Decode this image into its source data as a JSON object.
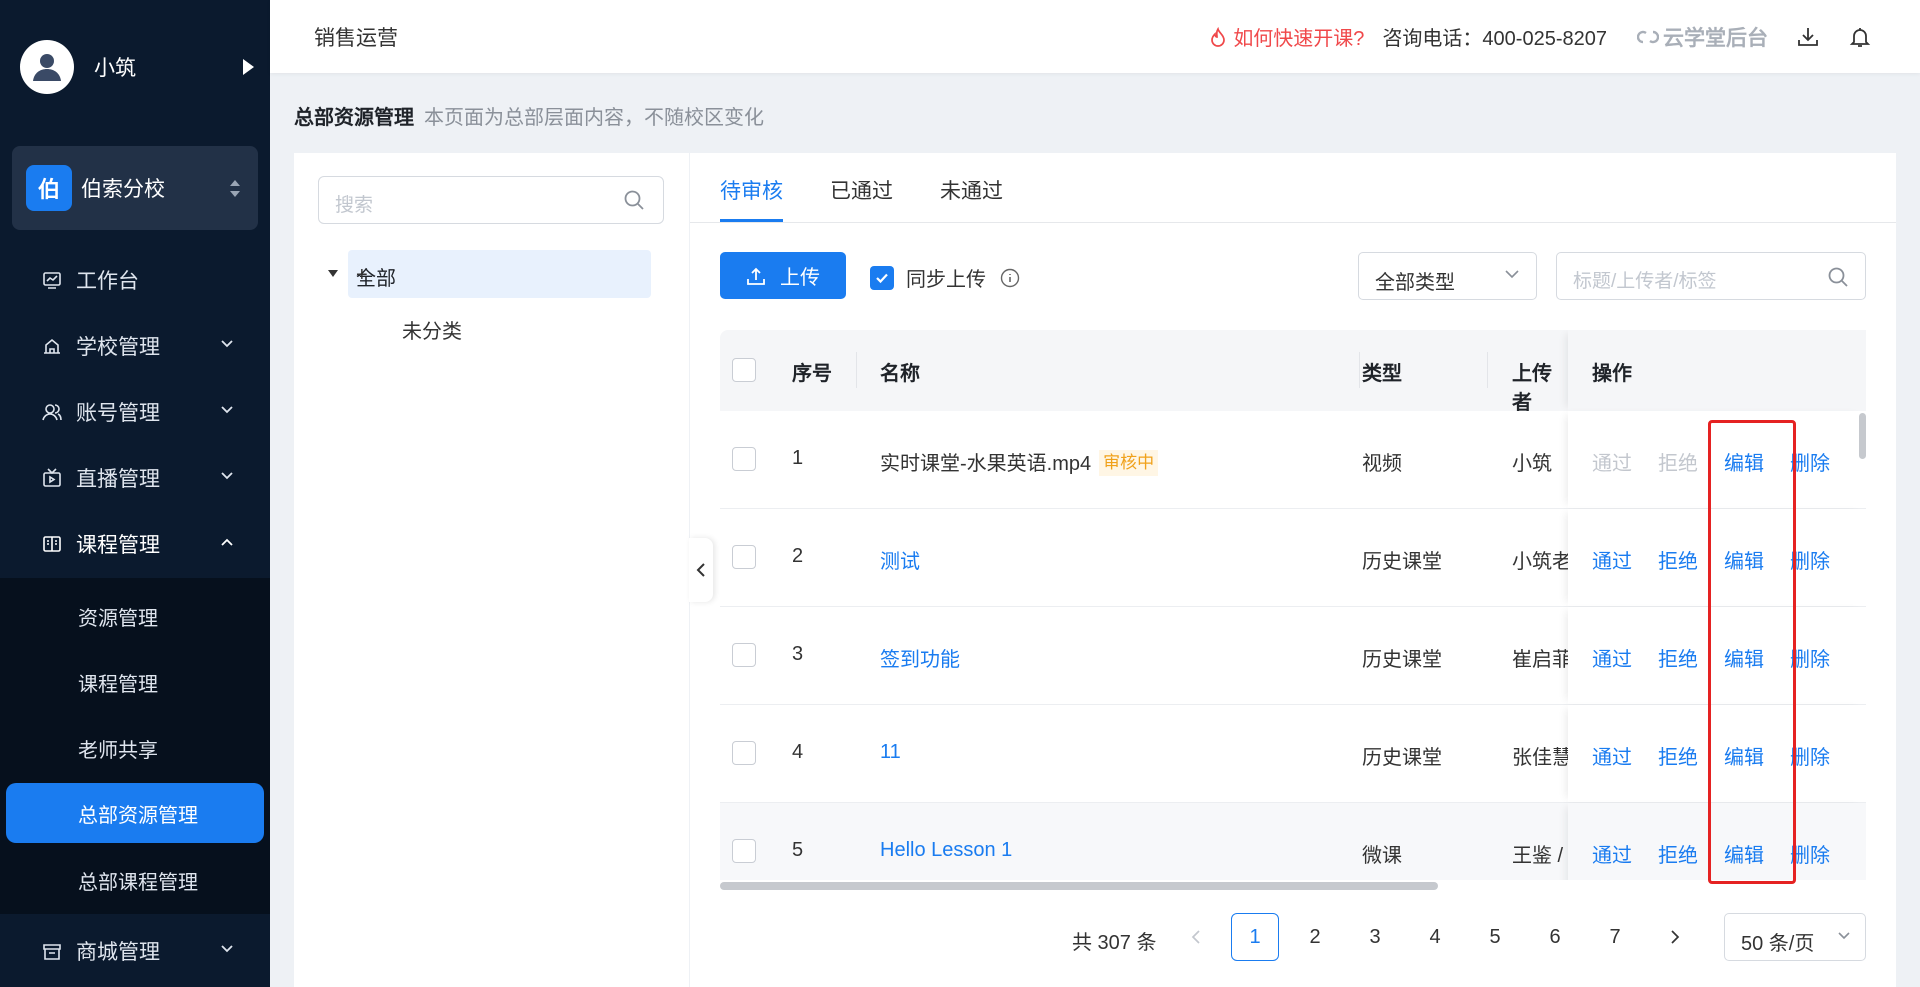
{
  "sidebar": {
    "username": "小筑",
    "school_logo": "伯",
    "school_name": "伯索分校",
    "nav": [
      {
        "label": "工作台",
        "icon": "dashboard-icon"
      },
      {
        "label": "学校管理",
        "icon": "school-icon"
      },
      {
        "label": "账号管理",
        "icon": "account-icon"
      },
      {
        "label": "直播管理",
        "icon": "live-icon"
      },
      {
        "label": "课程管理",
        "icon": "course-icon",
        "expanded": true
      },
      {
        "label": "商城管理",
        "icon": "shop-icon"
      }
    ],
    "sub_items": [
      "资源管理",
      "课程管理",
      "老师共享",
      "总部资源管理",
      "总部课程管理"
    ],
    "selected": "总部资源管理"
  },
  "topbar": {
    "title": "销售运营",
    "hot_link": "如何快速开课?",
    "phone": "咨询电话：400-025-8207",
    "brand": "云学堂后台"
  },
  "breadcrumb": {
    "title": "总部资源管理",
    "note": "本页面为总部层面内容，不随校区变化"
  },
  "tree": {
    "search_placeholder": "搜索",
    "root": "全部",
    "child": "未分类"
  },
  "tabs": [
    "待审核",
    "已通过",
    "未通过"
  ],
  "active_tab": "待审核",
  "toolbar": {
    "upload_label": "上传",
    "sync_label": "同步上传",
    "sync_checked": true,
    "type_select": "全部类型",
    "keyword_placeholder": "标题/上传者/标签"
  },
  "table": {
    "headers": {
      "index": "序号",
      "name": "名称",
      "type": "类型",
      "uploader": "上传者",
      "ops": "操作"
    },
    "rows": [
      {
        "index": "1",
        "name": "实时课堂-水果英语.mp4",
        "badge": "审核中",
        "type": "视频",
        "uploader": "小筑",
        "approve": "通过",
        "reject": "拒绝",
        "edit": "编辑",
        "del": "删除",
        "pending": true
      },
      {
        "index": "2",
        "name": "测试",
        "badge": "",
        "type": "历史课堂",
        "uploader": "小筑老师",
        "approve": "通过",
        "reject": "拒绝",
        "edit": "编辑",
        "del": "删除",
        "pending": false
      },
      {
        "index": "3",
        "name": "签到功能",
        "badge": "",
        "type": "历史课堂",
        "uploader": "崔启菲",
        "approve": "通过",
        "reject": "拒绝",
        "edit": "编辑",
        "del": "删除",
        "pending": false
      },
      {
        "index": "4",
        "name": "11",
        "badge": "",
        "type": "历史课堂",
        "uploader": "张佳慧",
        "approve": "通过",
        "reject": "拒绝",
        "edit": "编辑",
        "del": "删除",
        "pending": false
      },
      {
        "index": "5",
        "name": "Hello Lesson 1",
        "badge": "",
        "type": "微课",
        "uploader": "王鉴 /",
        "approve": "通过",
        "reject": "拒绝",
        "edit": "编辑",
        "del": "删除",
        "pending": false
      }
    ]
  },
  "pagination": {
    "total": "共 307 条",
    "pages": [
      "1",
      "2",
      "3",
      "4",
      "5",
      "6",
      "7"
    ],
    "current": "1",
    "page_size": "50 条/页"
  },
  "colors": {
    "accent": "#1a7cf0",
    "sidebar": "#0b1a2e",
    "danger": "#f0484a",
    "badge": "#f0a11b",
    "highlight": "#e52222"
  }
}
